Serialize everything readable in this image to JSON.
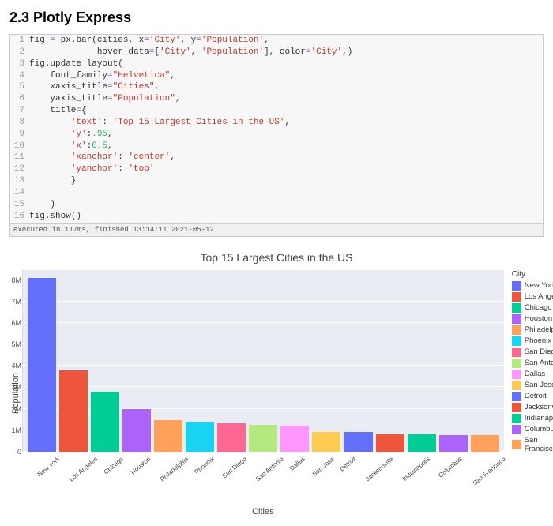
{
  "heading": "2.3  Plotly Express",
  "code": {
    "lines": [
      [
        {
          "t": "fig ",
          "c": ""
        },
        {
          "t": "=",
          "c": "op"
        },
        {
          "t": " px",
          "c": ""
        },
        {
          "t": ".",
          "c": ""
        },
        {
          "t": "bar(cities, x",
          "c": ""
        },
        {
          "t": "=",
          "c": "op"
        },
        {
          "t": "'City'",
          "c": "str"
        },
        {
          "t": ", y",
          "c": ""
        },
        {
          "t": "=",
          "c": "op"
        },
        {
          "t": "'Population'",
          "c": "str"
        },
        {
          "t": ",",
          "c": ""
        }
      ],
      [
        {
          "t": "             hover_data",
          "c": ""
        },
        {
          "t": "=",
          "c": "op"
        },
        {
          "t": "[",
          "c": ""
        },
        {
          "t": "'City'",
          "c": "str"
        },
        {
          "t": ", ",
          "c": ""
        },
        {
          "t": "'Population'",
          "c": "str"
        },
        {
          "t": "], color",
          "c": ""
        },
        {
          "t": "=",
          "c": "op"
        },
        {
          "t": "'City'",
          "c": "str"
        },
        {
          "t": ",)",
          "c": ""
        }
      ],
      [
        {
          "t": "fig",
          "c": ""
        },
        {
          "t": ".",
          "c": ""
        },
        {
          "t": "update_layout(",
          "c": ""
        }
      ],
      [
        {
          "t": "    font_family",
          "c": ""
        },
        {
          "t": "=",
          "c": "op"
        },
        {
          "t": "\"Helvetica\"",
          "c": "str"
        },
        {
          "t": ",",
          "c": ""
        }
      ],
      [
        {
          "t": "    xaxis_title",
          "c": ""
        },
        {
          "t": "=",
          "c": "op"
        },
        {
          "t": "\"Cities\"",
          "c": "str"
        },
        {
          "t": ",",
          "c": ""
        }
      ],
      [
        {
          "t": "    yaxis_title",
          "c": ""
        },
        {
          "t": "=",
          "c": "op"
        },
        {
          "t": "\"Population\"",
          "c": "str"
        },
        {
          "t": ",",
          "c": ""
        }
      ],
      [
        {
          "t": "    title",
          "c": ""
        },
        {
          "t": "=",
          "c": "op"
        },
        {
          "t": "{",
          "c": ""
        }
      ],
      [
        {
          "t": "        ",
          "c": ""
        },
        {
          "t": "'text'",
          "c": "str"
        },
        {
          "t": ": ",
          "c": ""
        },
        {
          "t": "'Top 15 Largest Cities in the US'",
          "c": "str"
        },
        {
          "t": ",",
          "c": ""
        }
      ],
      [
        {
          "t": "        ",
          "c": ""
        },
        {
          "t": "'y'",
          "c": "str"
        },
        {
          "t": ":",
          "c": ""
        },
        {
          "t": ".95",
          "c": "num"
        },
        {
          "t": ",",
          "c": ""
        }
      ],
      [
        {
          "t": "        ",
          "c": ""
        },
        {
          "t": "'x'",
          "c": "str"
        },
        {
          "t": ":",
          "c": ""
        },
        {
          "t": "0.5",
          "c": "num"
        },
        {
          "t": ",",
          "c": ""
        }
      ],
      [
        {
          "t": "        ",
          "c": ""
        },
        {
          "t": "'xanchor'",
          "c": "str"
        },
        {
          "t": ": ",
          "c": ""
        },
        {
          "t": "'center'",
          "c": "str"
        },
        {
          "t": ",",
          "c": ""
        }
      ],
      [
        {
          "t": "        ",
          "c": ""
        },
        {
          "t": "'yanchor'",
          "c": "str"
        },
        {
          "t": ": ",
          "c": ""
        },
        {
          "t": "'top'",
          "c": "str"
        }
      ],
      [
        {
          "t": "        }",
          "c": ""
        }
      ],
      [
        {
          "t": "",
          "c": ""
        }
      ],
      [
        {
          "t": "    )",
          "c": ""
        }
      ],
      [
        {
          "t": "fig",
          "c": ""
        },
        {
          "t": ".",
          "c": ""
        },
        {
          "t": "show()",
          "c": ""
        }
      ]
    ],
    "status": "executed in 117ms, finished 13:14:11 2021-05-12"
  },
  "chart_data": {
    "type": "bar",
    "title": "Top 15 Largest Cities in the US",
    "xlabel": "Cities",
    "ylabel": "Population",
    "legend_title": "City",
    "ylim": [
      0,
      8500000
    ],
    "yticks": [
      0,
      1000000,
      2000000,
      3000000,
      4000000,
      5000000,
      6000000,
      7000000,
      8000000
    ],
    "ytick_labels": [
      "0",
      "1M",
      "2M",
      "3M",
      "4M",
      "5M",
      "6M",
      "7M",
      "8M"
    ],
    "categories": [
      "New York",
      "Los Angeles",
      "Chicago",
      "Houston",
      "Philadelphia",
      "Phoenix",
      "San Diego",
      "San Antonio",
      "Dallas",
      "San Jose",
      "Detroit",
      "Jacksonville",
      "Indianapolis",
      "Columbus",
      "San Francisco"
    ],
    "values": [
      8100000,
      3800000,
      2800000,
      2000000,
      1450000,
      1400000,
      1300000,
      1250000,
      1200000,
      900000,
      900000,
      800000,
      790000,
      780000,
      770000
    ],
    "colors": [
      "#636EFA",
      "#EF553B",
      "#00CC96",
      "#AB63FA",
      "#FFA15A",
      "#19D3F3",
      "#FF6692",
      "#B6E880",
      "#FF97FF",
      "#FECB52",
      "#636EFA",
      "#EF553B",
      "#00CC96",
      "#AB63FA",
      "#FFA15A"
    ]
  }
}
